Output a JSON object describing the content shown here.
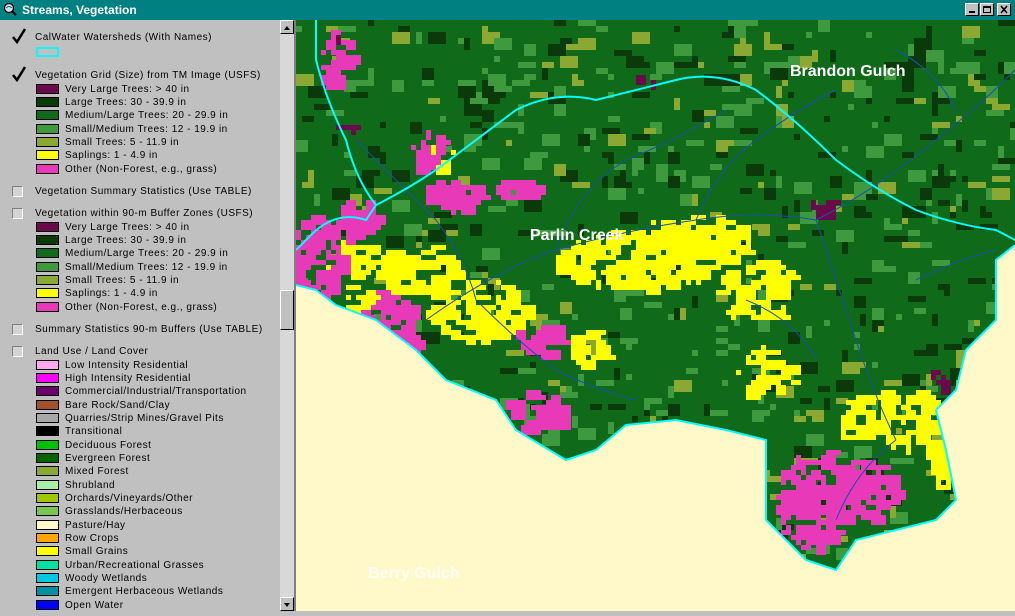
{
  "window": {
    "title": "Streams, Vegetation",
    "app_icon": "magnifier-globe-icon",
    "controls": [
      "minimize-icon",
      "maximize-icon",
      "close-icon"
    ]
  },
  "legend": {
    "themes": [
      {
        "label": "CalWater Watersheds (With Names)",
        "checked": true,
        "outline_color": "#00ffff"
      },
      {
        "label": "Vegetation Grid (Size) from TM Image (USFS)",
        "checked": true,
        "classes": [
          {
            "label": "Very Large Trees: > 40  in",
            "color": "#6b0a4a"
          },
          {
            "label": "Large Trees: 30 - 39.9 in",
            "color": "#0a3a0a"
          },
          {
            "label": "Medium/Large Trees: 20 - 29.9 in",
            "color": "#0f6a1a"
          },
          {
            "label": "Small/Medium Trees: 12 - 19.9 in",
            "color": "#3f9a3f"
          },
          {
            "label": "Small Trees: 5 - 11.9 in",
            "color": "#8aa832"
          },
          {
            "label": "Saplings: 1 - 4.9 in",
            "color": "#ffff00"
          },
          {
            "label": "Other (Non-Forest, e.g., grass)",
            "color": "#e83ab8"
          }
        ]
      },
      {
        "label": "Vegetation Summary Statistics (Use TABLE)",
        "checked": false
      },
      {
        "label": "Vegetation within 90-m Buffer Zones (USFS)",
        "checked": false,
        "classes": [
          {
            "label": "Very Large Trees: > 40  in",
            "color": "#6b0a4a"
          },
          {
            "label": "Large Trees: 30 - 39.9 in",
            "color": "#0a3a0a"
          },
          {
            "label": "Medium/Large Trees: 20 - 29.9 in",
            "color": "#0f6a1a"
          },
          {
            "label": "Small/Medium Trees: 12 - 19.9 in",
            "color": "#3f9a3f"
          },
          {
            "label": "Small Trees: 5 - 11.9 in",
            "color": "#8aa832"
          },
          {
            "label": "Saplings: 1 - 4.9 in",
            "color": "#ffff00"
          },
          {
            "label": "Other (Non-Forest, e.g., grass)",
            "color": "#e83ab8"
          }
        ]
      },
      {
        "label": "Summary Statistics 90-m Buffers (Use TABLE)",
        "checked": false
      },
      {
        "label": "Land Use / Land Cover",
        "checked": false,
        "classes": [
          {
            "label": "Low Intensity Residential",
            "color": "#ffa8f0"
          },
          {
            "label": "High Intensity Residential",
            "color": "#ff00ff"
          },
          {
            "label": "Commercial/Industrial/Transportation",
            "color": "#6b006b"
          },
          {
            "label": "Bare Rock/Sand/Clay",
            "color": "#a0522d"
          },
          {
            "label": "Quarries/Strip Mines/Gravel Pits",
            "color": "#a8a8a8"
          },
          {
            "label": "Transitional",
            "color": "#000000"
          },
          {
            "label": "Deciduous Forest",
            "color": "#00c000"
          },
          {
            "label": "Evergreen Forest",
            "color": "#006400"
          },
          {
            "label": "Mixed Forest",
            "color": "#8aa832"
          },
          {
            "label": "Shrubland",
            "color": "#a8f0a8"
          },
          {
            "label": "Orchards/Vineyards/Other",
            "color": "#a0c800"
          },
          {
            "label": "Grasslands/Herbaceous",
            "color": "#78c850"
          },
          {
            "label": "Pasture/Hay",
            "color": "#fff8c8"
          },
          {
            "label": "Row Crops",
            "color": "#ffa500"
          },
          {
            "label": "Small Grains",
            "color": "#ffff00"
          },
          {
            "label": "Urban/Recreational Grasses",
            "color": "#00e0a0"
          },
          {
            "label": "Woody Wetlands",
            "color": "#00c8e0"
          },
          {
            "label": "Emergent Herbaceous Wetlands",
            "color": "#0090a0"
          },
          {
            "label": "Open Water",
            "color": "#0000ff"
          }
        ]
      }
    ]
  },
  "map": {
    "background_color": "#fff8c8",
    "watershed_color": "#00ffff",
    "stream_color": "#1a4fb0",
    "labels": [
      {
        "text": "Brandon Gulch"
      },
      {
        "text": "Parlin Creek"
      },
      {
        "text": "Berry Gulch"
      }
    ]
  }
}
